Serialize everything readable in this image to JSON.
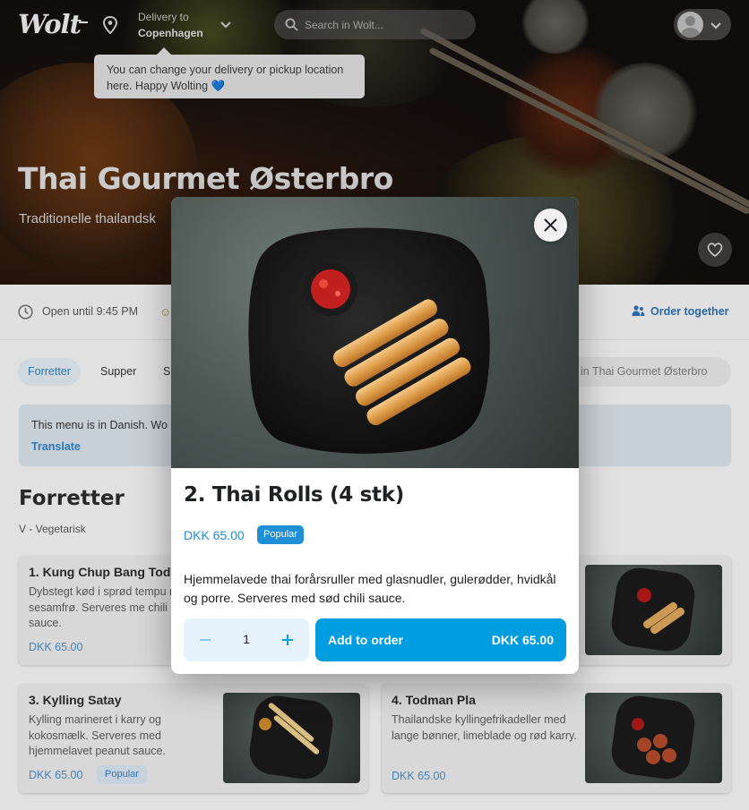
{
  "header": {
    "logo": "Wolt",
    "delivery_label": "Delivery to",
    "delivery_city": "Copenhagen",
    "search_placeholder": "Search in Wolt...",
    "tooltip": "You can change your delivery or pickup location here. Happy Wolting 💙"
  },
  "venue": {
    "title": "Thai Gourmet Østerbro",
    "subtitle": "Traditionelle thailandsk",
    "open_text": "Open until 9:45 PM",
    "order_together": "Order together"
  },
  "categories": [
    {
      "label": "Forretter",
      "active": true
    },
    {
      "label": "Supper",
      "active": false
    },
    {
      "label": "S",
      "active": false
    }
  ],
  "menu_search_text": "in Thai Gourmet Østerbro",
  "translate": {
    "message": "This menu is in Danish. Wo",
    "link": "Translate"
  },
  "section": {
    "title": "Forretter",
    "subtitle": "V - Vegetarisk"
  },
  "items": [
    {
      "name": "1. Kung Chup Bang Tod",
      "desc": "Dybstegt kød i sprød tempu med sesamfrø. Serveres me chili sauce.",
      "price": "DKK 65.00",
      "popular": ""
    },
    {
      "name": "3. Kylling Satay",
      "desc": "Kylling marineret i karry og kokosmælk. Serveres med hjemmelavet peanut sauce.",
      "price": "DKK 65.00",
      "popular": "Popular"
    },
    {
      "name": "4. Todman Pla",
      "desc": "Thailandske kyllingefrikadeller med lange bønner, limeblade og rød karry.",
      "price": "DKK 65.00",
      "popular": ""
    }
  ],
  "modal": {
    "title": "2. Thai Rolls (4 stk)",
    "price": "DKK 65.00",
    "badge": "Popular",
    "description": "Hjemmelavede thai forårsruller med glasnudler, gulerødder, hvidkål og porre. Serveres med sød chili sauce.",
    "quantity": "1",
    "add_label": "Add to order",
    "add_amount": "DKK 65.00"
  },
  "colors": {
    "accent": "#009de0",
    "accent_light": "#e6f3fc",
    "link": "#2f7fc1"
  },
  "icons": [
    "pin-icon",
    "chevron-down-icon",
    "search-icon",
    "avatar-icon",
    "heart-icon",
    "clock-icon",
    "smile-icon",
    "group-icon",
    "close-icon",
    "minus-icon",
    "plus-icon"
  ]
}
